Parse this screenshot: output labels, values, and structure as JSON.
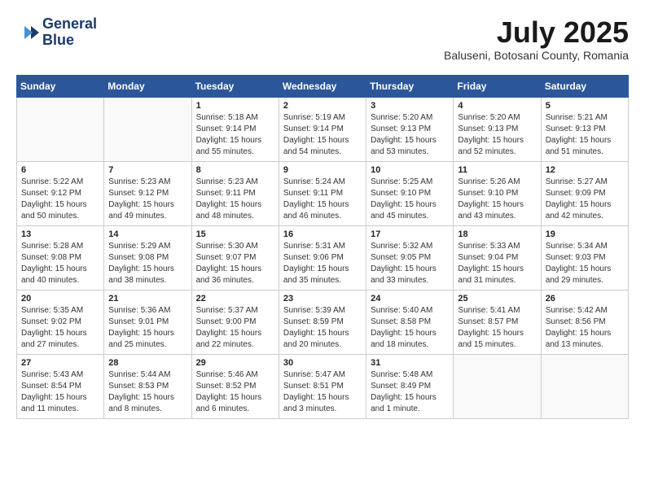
{
  "logo": {
    "line1": "General",
    "line2": "Blue"
  },
  "title": {
    "month_year": "July 2025",
    "location": "Baluseni, Botosani County, Romania"
  },
  "weekdays": [
    "Sunday",
    "Monday",
    "Tuesday",
    "Wednesday",
    "Thursday",
    "Friday",
    "Saturday"
  ],
  "weeks": [
    [
      {
        "day": "",
        "info": ""
      },
      {
        "day": "",
        "info": ""
      },
      {
        "day": "1",
        "info": "Sunrise: 5:18 AM\nSunset: 9:14 PM\nDaylight: 15 hours and 55 minutes."
      },
      {
        "day": "2",
        "info": "Sunrise: 5:19 AM\nSunset: 9:14 PM\nDaylight: 15 hours and 54 minutes."
      },
      {
        "day": "3",
        "info": "Sunrise: 5:20 AM\nSunset: 9:13 PM\nDaylight: 15 hours and 53 minutes."
      },
      {
        "day": "4",
        "info": "Sunrise: 5:20 AM\nSunset: 9:13 PM\nDaylight: 15 hours and 52 minutes."
      },
      {
        "day": "5",
        "info": "Sunrise: 5:21 AM\nSunset: 9:13 PM\nDaylight: 15 hours and 51 minutes."
      }
    ],
    [
      {
        "day": "6",
        "info": "Sunrise: 5:22 AM\nSunset: 9:12 PM\nDaylight: 15 hours and 50 minutes."
      },
      {
        "day": "7",
        "info": "Sunrise: 5:23 AM\nSunset: 9:12 PM\nDaylight: 15 hours and 49 minutes."
      },
      {
        "day": "8",
        "info": "Sunrise: 5:23 AM\nSunset: 9:11 PM\nDaylight: 15 hours and 48 minutes."
      },
      {
        "day": "9",
        "info": "Sunrise: 5:24 AM\nSunset: 9:11 PM\nDaylight: 15 hours and 46 minutes."
      },
      {
        "day": "10",
        "info": "Sunrise: 5:25 AM\nSunset: 9:10 PM\nDaylight: 15 hours and 45 minutes."
      },
      {
        "day": "11",
        "info": "Sunrise: 5:26 AM\nSunset: 9:10 PM\nDaylight: 15 hours and 43 minutes."
      },
      {
        "day": "12",
        "info": "Sunrise: 5:27 AM\nSunset: 9:09 PM\nDaylight: 15 hours and 42 minutes."
      }
    ],
    [
      {
        "day": "13",
        "info": "Sunrise: 5:28 AM\nSunset: 9:08 PM\nDaylight: 15 hours and 40 minutes."
      },
      {
        "day": "14",
        "info": "Sunrise: 5:29 AM\nSunset: 9:08 PM\nDaylight: 15 hours and 38 minutes."
      },
      {
        "day": "15",
        "info": "Sunrise: 5:30 AM\nSunset: 9:07 PM\nDaylight: 15 hours and 36 minutes."
      },
      {
        "day": "16",
        "info": "Sunrise: 5:31 AM\nSunset: 9:06 PM\nDaylight: 15 hours and 35 minutes."
      },
      {
        "day": "17",
        "info": "Sunrise: 5:32 AM\nSunset: 9:05 PM\nDaylight: 15 hours and 33 minutes."
      },
      {
        "day": "18",
        "info": "Sunrise: 5:33 AM\nSunset: 9:04 PM\nDaylight: 15 hours and 31 minutes."
      },
      {
        "day": "19",
        "info": "Sunrise: 5:34 AM\nSunset: 9:03 PM\nDaylight: 15 hours and 29 minutes."
      }
    ],
    [
      {
        "day": "20",
        "info": "Sunrise: 5:35 AM\nSunset: 9:02 PM\nDaylight: 15 hours and 27 minutes."
      },
      {
        "day": "21",
        "info": "Sunrise: 5:36 AM\nSunset: 9:01 PM\nDaylight: 15 hours and 25 minutes."
      },
      {
        "day": "22",
        "info": "Sunrise: 5:37 AM\nSunset: 9:00 PM\nDaylight: 15 hours and 22 minutes."
      },
      {
        "day": "23",
        "info": "Sunrise: 5:39 AM\nSunset: 8:59 PM\nDaylight: 15 hours and 20 minutes."
      },
      {
        "day": "24",
        "info": "Sunrise: 5:40 AM\nSunset: 8:58 PM\nDaylight: 15 hours and 18 minutes."
      },
      {
        "day": "25",
        "info": "Sunrise: 5:41 AM\nSunset: 8:57 PM\nDaylight: 15 hours and 15 minutes."
      },
      {
        "day": "26",
        "info": "Sunrise: 5:42 AM\nSunset: 8:56 PM\nDaylight: 15 hours and 13 minutes."
      }
    ],
    [
      {
        "day": "27",
        "info": "Sunrise: 5:43 AM\nSunset: 8:54 PM\nDaylight: 15 hours and 11 minutes."
      },
      {
        "day": "28",
        "info": "Sunrise: 5:44 AM\nSunset: 8:53 PM\nDaylight: 15 hours and 8 minutes."
      },
      {
        "day": "29",
        "info": "Sunrise: 5:46 AM\nSunset: 8:52 PM\nDaylight: 15 hours and 6 minutes."
      },
      {
        "day": "30",
        "info": "Sunrise: 5:47 AM\nSunset: 8:51 PM\nDaylight: 15 hours and 3 minutes."
      },
      {
        "day": "31",
        "info": "Sunrise: 5:48 AM\nSunset: 8:49 PM\nDaylight: 15 hours and 1 minute."
      },
      {
        "day": "",
        "info": ""
      },
      {
        "day": "",
        "info": ""
      }
    ]
  ]
}
